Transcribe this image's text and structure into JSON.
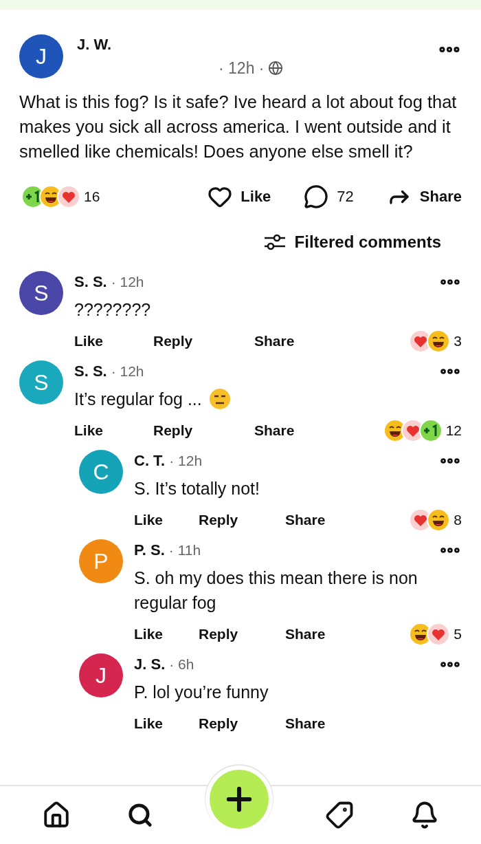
{
  "post": {
    "author": {
      "initial": "J",
      "name": "J. W.",
      "color": "#1f55b8"
    },
    "time": "· 12h ·",
    "text": "What is this fog? Is it safe? Ive heard a lot about fog that makes you sick all across america. I went outside and it smelled like chemicals! Does anyone else smell it?",
    "reactions": [
      {
        "kind": "plusone"
      },
      {
        "kind": "haha"
      },
      {
        "kind": "love"
      }
    ],
    "reaction_count": "16",
    "like_label": "Like",
    "comment_count": "72",
    "share_label": "Share"
  },
  "filter": {
    "label": "Filtered comments"
  },
  "comments": [
    {
      "initial": "S",
      "name": "S. S.",
      "color": "#4a47a8",
      "time": "· 12h",
      "text": "????????",
      "reactions": [
        {
          "kind": "love"
        },
        {
          "kind": "haha"
        }
      ],
      "reaction_count": "3",
      "actions": [
        "Like",
        "Reply",
        "Share"
      ]
    },
    {
      "initial": "S",
      "name": "S. S.",
      "color": "#1aa8bd",
      "time": "· 12h",
      "text": "It’s regular fog ...",
      "trailing_emoji": {
        "kind": "neutral"
      },
      "reactions": [
        {
          "kind": "haha"
        },
        {
          "kind": "love"
        },
        {
          "kind": "plusone"
        }
      ],
      "reaction_count": "12",
      "actions": [
        "Like",
        "Reply",
        "Share"
      ],
      "children": [
        {
          "initial": "C",
          "name": "C. T.",
          "color": "#15a3b8",
          "time": "· 12h",
          "text": "S. It’s totally not!",
          "reactions": [
            {
              "kind": "love"
            },
            {
              "kind": "haha"
            }
          ],
          "reaction_count": "8",
          "actions": [
            "Like",
            "Reply",
            "Share"
          ]
        },
        {
          "initial": "P",
          "name": "P. S.",
          "color": "#f08a12",
          "time": "· 11h",
          "text": "S. oh my does this mean there is non regular fog",
          "reactions": [
            {
              "kind": "haha"
            },
            {
              "kind": "love"
            }
          ],
          "reaction_count": "5",
          "actions": [
            "Like",
            "Reply",
            "Share"
          ]
        },
        {
          "initial": "J",
          "name": "J. S.",
          "color": "#d4264f",
          "time": "· 6h",
          "text": "P. lol you’re funny",
          "actions": [
            "Like",
            "Reply",
            "Share"
          ]
        }
      ]
    }
  ],
  "nav": [
    {
      "kind": "home"
    },
    {
      "kind": "search"
    },
    {
      "kind": "create"
    },
    {
      "kind": "tag"
    },
    {
      "kind": "bell"
    }
  ]
}
